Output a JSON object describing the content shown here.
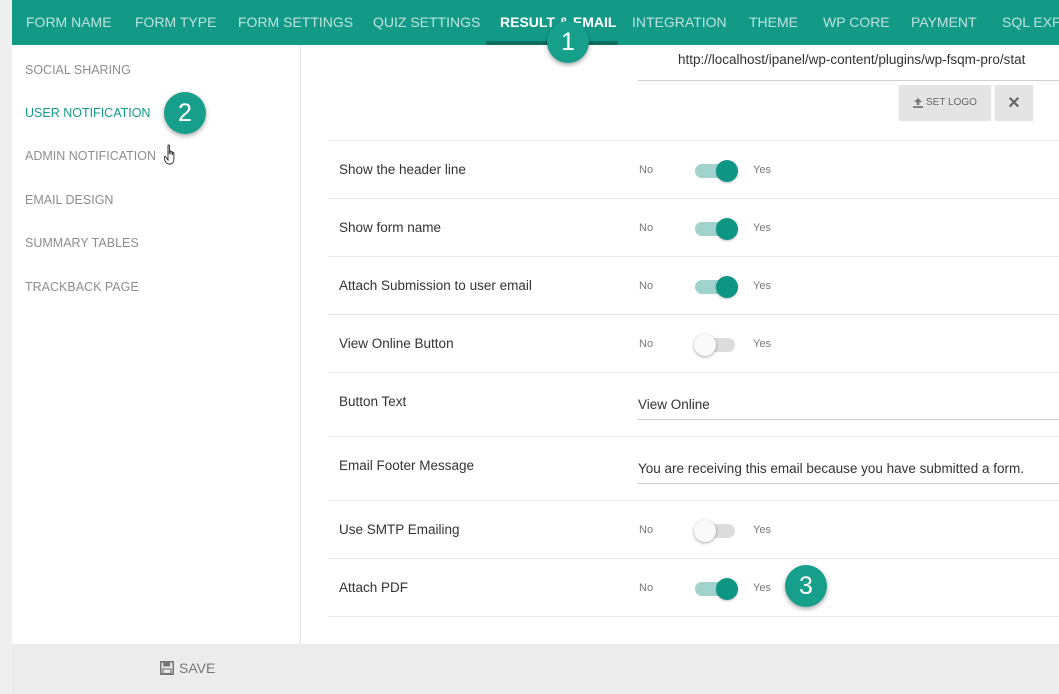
{
  "nav": {
    "tabs": [
      {
        "label": "FORM NAME"
      },
      {
        "label": "FORM TYPE"
      },
      {
        "label": "FORM SETTINGS"
      },
      {
        "label": "QUIZ SETTINGS"
      },
      {
        "label": "RESULT & EMAIL",
        "active": true
      },
      {
        "label": "INTEGRATION"
      },
      {
        "label": "THEME"
      },
      {
        "label": "WP CORE"
      },
      {
        "label": "PAYMENT"
      },
      {
        "label": "SQL EXPO"
      }
    ]
  },
  "sidebar": {
    "items": [
      {
        "label": "SOCIAL SHARING"
      },
      {
        "label": "USER NOTIFICATION",
        "active": true
      },
      {
        "label": "ADMIN NOTIFICATION"
      },
      {
        "label": "EMAIL DESIGN"
      },
      {
        "label": "SUMMARY TABLES"
      },
      {
        "label": "TRACKBACK PAGE"
      }
    ]
  },
  "logo": {
    "url": "http://localhost/ipanel/wp-content/plugins/wp-fsqm-pro/stat",
    "set_logo_label": "SET LOGO",
    "upload_icon": "upload-icon",
    "close_icon": "close-icon"
  },
  "rows": [
    {
      "label": "Show the header line",
      "type": "toggle",
      "on": true,
      "no": "No",
      "yes": "Yes"
    },
    {
      "label": "Show form name",
      "type": "toggle",
      "on": true,
      "no": "No",
      "yes": "Yes"
    },
    {
      "label": "Attach Submission to user email",
      "type": "toggle",
      "on": true,
      "no": "No",
      "yes": "Yes"
    },
    {
      "label": "View Online Button",
      "type": "toggle",
      "on": false,
      "no": "No",
      "yes": "Yes"
    },
    {
      "label": "Button Text",
      "type": "text",
      "value": "View Online"
    },
    {
      "label": "Email Footer Message",
      "type": "text",
      "value": "You are receiving this email because you have submitted a form."
    },
    {
      "label": "Use SMTP Emailing",
      "type": "toggle",
      "on": false,
      "no": "No",
      "yes": "Yes"
    },
    {
      "label": "Attach PDF",
      "type": "toggle",
      "on": true,
      "no": "No",
      "yes": "Yes"
    }
  ],
  "footer": {
    "save_label": "SAVE",
    "save_icon": "floppy-disk-icon"
  },
  "badges": [
    "1",
    "2",
    "3"
  ],
  "colors": {
    "accent": "#139a87",
    "toggle_on": "#0f9584",
    "toggle_track_on": "#9fd3cb"
  }
}
